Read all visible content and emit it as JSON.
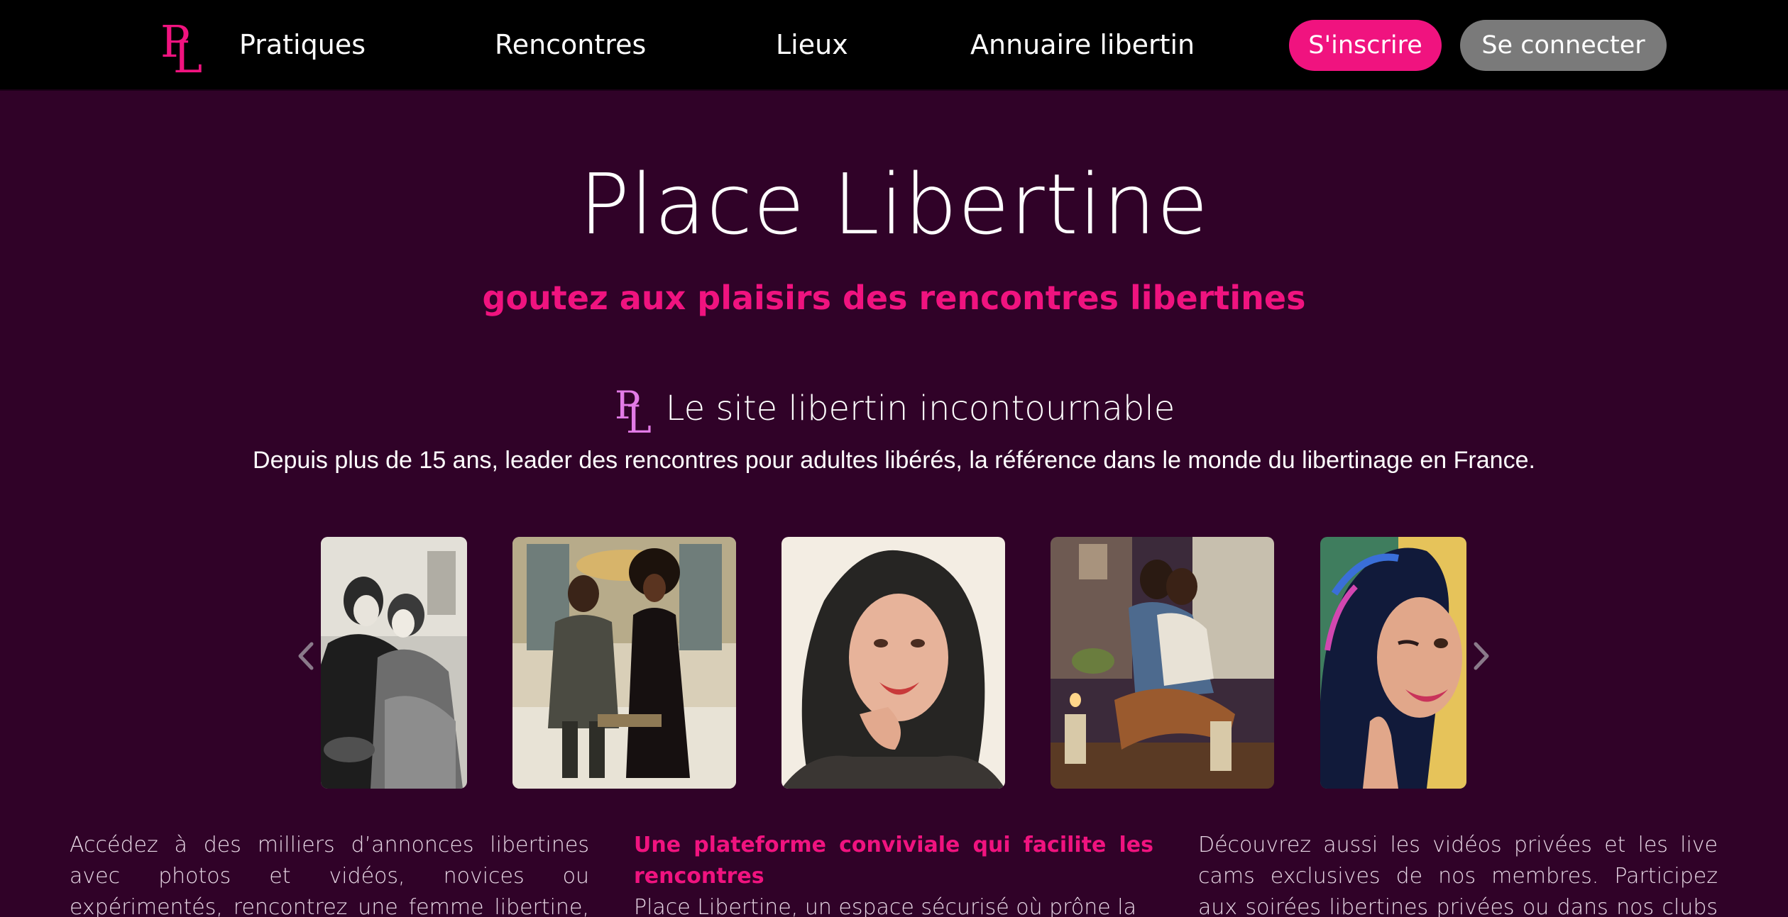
{
  "nav": {
    "items": [
      {
        "label": "Pratiques"
      },
      {
        "label": "Rencontres"
      },
      {
        "label": "Lieux"
      },
      {
        "label": "Annuaire libertin"
      }
    ],
    "signup_label": "S'inscrire",
    "login_label": "Se connecter"
  },
  "hero": {
    "title": "Place Libertine",
    "subtitle": "goutez aux plaisirs des rencontres libertines",
    "tagline": "Le site libertin incontournable",
    "intro": "Depuis plus de 15 ans, leader des rencontres pour adultes libérés, la référence dans le monde du libertinage en France."
  },
  "carousel": {
    "prev_icon": "chevron-left-icon",
    "next_icon": "chevron-right-icon",
    "items": [
      {
        "icon": "illustration-vintage-couple"
      },
      {
        "icon": "illustration-couple-lounge"
      },
      {
        "icon": "illustration-smiling-woman"
      },
      {
        "icon": "illustration-embracing-couple"
      },
      {
        "icon": "illustration-winking-woman"
      }
    ]
  },
  "features": [
    {
      "heading": "",
      "text": "Accédez à des milliers d’annonces libertines avec photos et vidéos, novices ou expérimentés, rencontrez une femme libertine, un couple"
    },
    {
      "heading": "Une plateforme conviviale qui facilite les rencontres",
      "text": "Place Libertine, un espace sécurisé où prône la"
    },
    {
      "heading": "",
      "text": "Découvrez aussi les vidéos privées et les live cams exclusives de nos membres. Participez aux soirées libertines privées ou dans nos clubs libertins"
    }
  ],
  "colors": {
    "background": "#300228",
    "navbar": "#000000",
    "accent": "#f0137f",
    "login_button": "#7a7a7a",
    "logo_pink": "#f0137f",
    "mini_logo_pink": "#e27be6"
  }
}
